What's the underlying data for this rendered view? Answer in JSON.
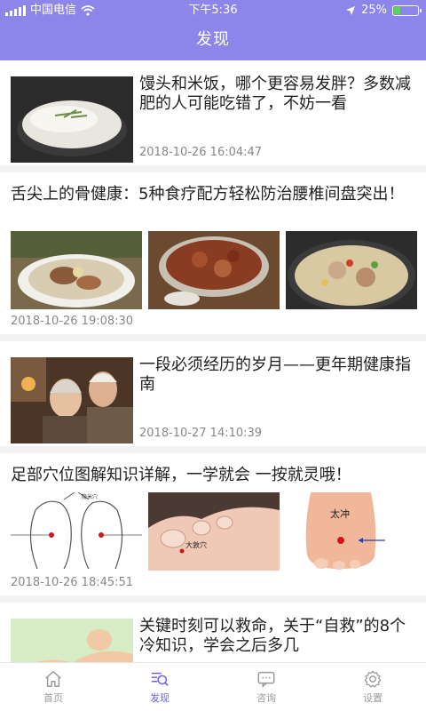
{
  "status_bar": {
    "carrier": "中国电信",
    "time": "下午5:36",
    "battery_text": "25%",
    "battery_level": 0.25,
    "battery_color": "#5ad55a"
  },
  "header": {
    "title": "发现",
    "background": "#8c86ea"
  },
  "articles": [
    {
      "title": "馒头和米饭，哪个更容易发胖？多数减肥的人可能吃错了，不妨一看",
      "date": "2018-10-26 16:04:47",
      "layout": "thumb-left",
      "images": [
        "rice-bowl-photo"
      ]
    },
    {
      "title": "舌尖上的骨健康：5种食疗配方轻松防治腰椎间盘突出！",
      "date": "2018-10-26 19:08:30",
      "layout": "three-images",
      "images": [
        "bone-soup-photo",
        "braised-meat-photo",
        "stew-pot-photo"
      ]
    },
    {
      "title": "一段必须经历的岁月——更年期健康指南",
      "date": "2018-10-27 14:10:39",
      "layout": "thumb-left",
      "images": [
        "elderly-couple-photo"
      ]
    },
    {
      "title": "足部穴位图解知识详解，一学就会 一按就灵哦！",
      "date": "2018-10-26 18:45:51",
      "layout": "three-images",
      "images": [
        "foot-acupoint-diagram",
        "toe-acupoint-photo",
        "foot-acupoint-photo"
      ],
      "image_labels": {
        "diagram": "隐米穴",
        "toe": "大敦穴",
        "foot": "太冲"
      }
    },
    {
      "title": "关键时刻可以救命，关于“自救”的8个冷知识，学会之后多几",
      "date": "",
      "layout": "thumb-left",
      "images": [
        "first-aid-illustration"
      ]
    }
  ],
  "tabbar": {
    "active_color": "#6a62d6",
    "tabs": [
      {
        "label": "首页",
        "icon": "home-icon",
        "active": false
      },
      {
        "label": "发现",
        "icon": "discover-icon",
        "active": true
      },
      {
        "label": "咨询",
        "icon": "chat-icon",
        "active": false
      },
      {
        "label": "设置",
        "icon": "settings-icon",
        "active": false
      }
    ]
  }
}
